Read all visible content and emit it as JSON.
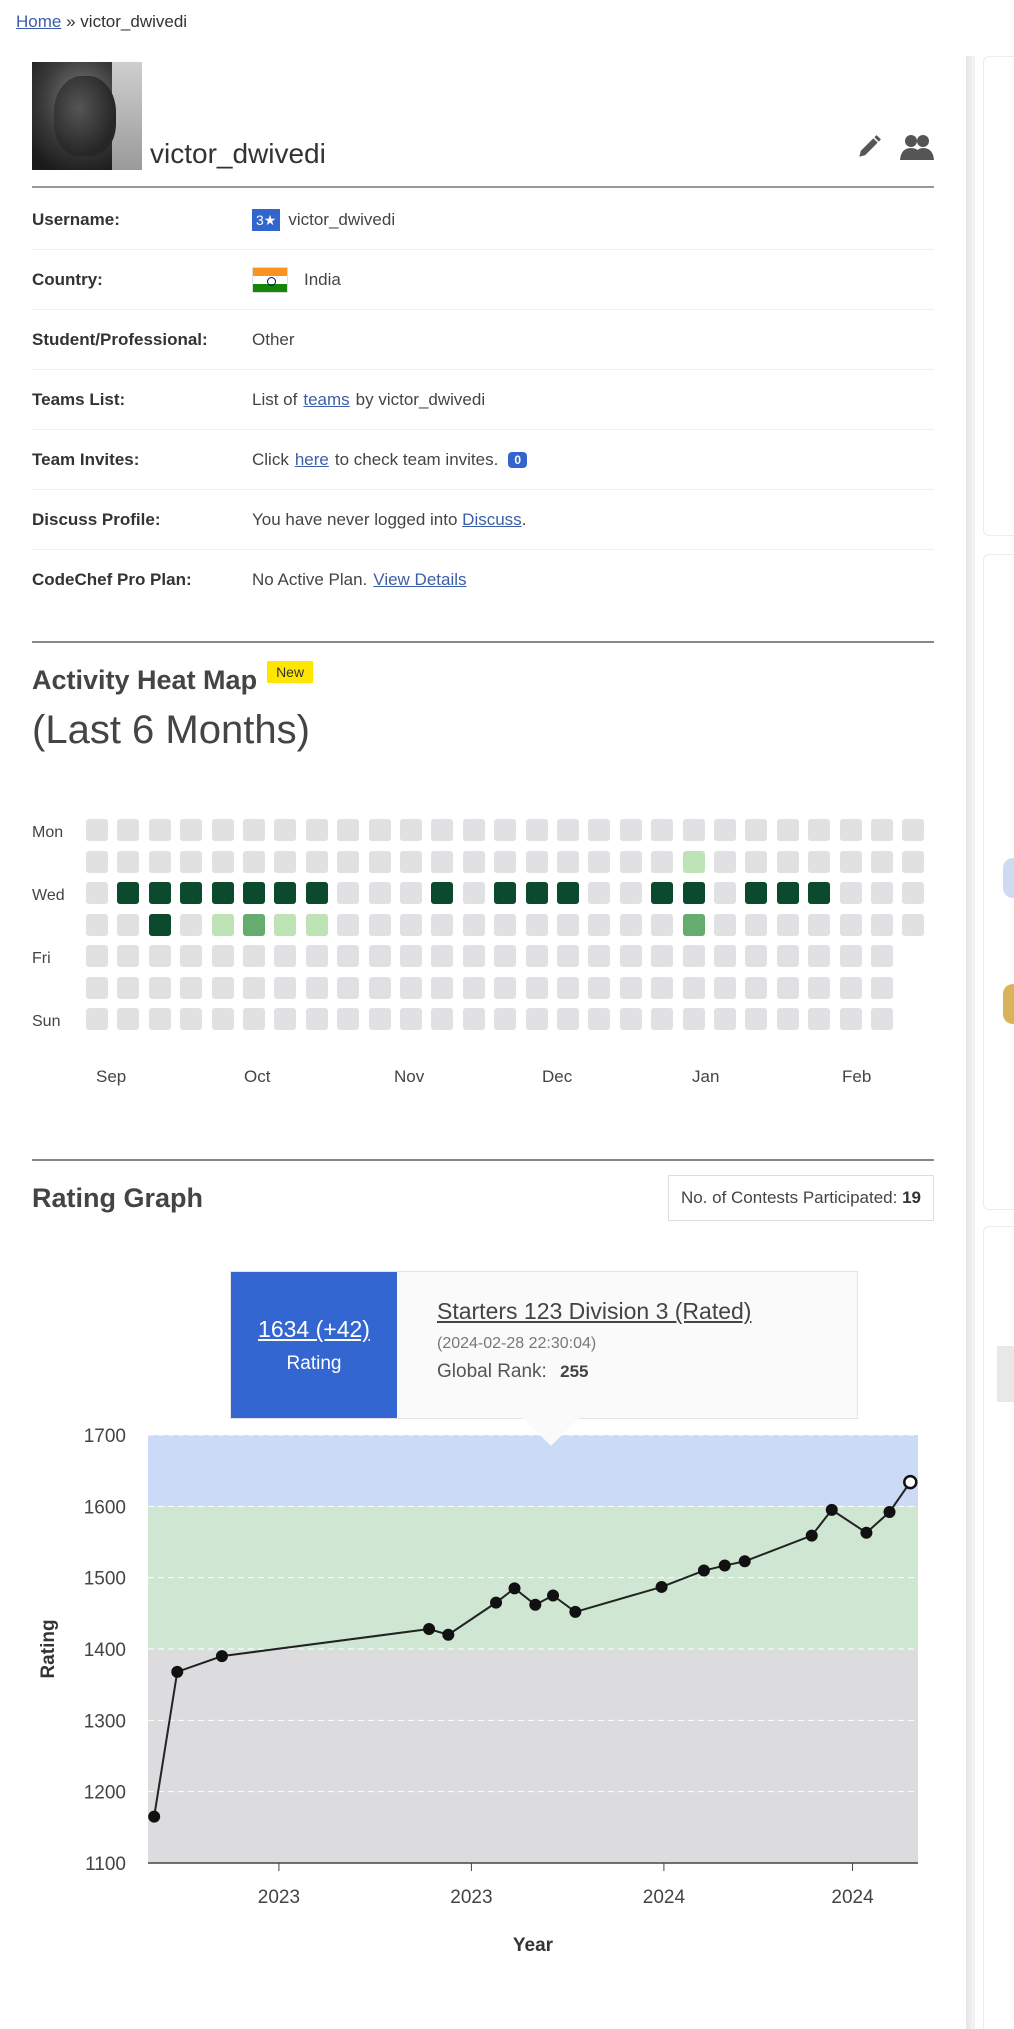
{
  "breadcrumb": {
    "home": "Home",
    "separator": "»",
    "current": "victor_dwivedi"
  },
  "profile": {
    "display_name": "victor_dwivedi",
    "edit_icon": "pencil-icon",
    "users_icon": "users-icon",
    "rows": {
      "username": {
        "label": "Username:",
        "stars": "3★",
        "value": "victor_dwivedi"
      },
      "country": {
        "label": "Country:",
        "value": "India"
      },
      "student": {
        "label": "Student/Professional:",
        "value": "Other"
      },
      "teams": {
        "label": "Teams List:",
        "prefix": "List of",
        "link": "teams",
        "suffix": "by victor_dwivedi"
      },
      "invites": {
        "label": "Team Invites:",
        "prefix": "Click",
        "link": "here",
        "suffix": "to check team invites.",
        "count": "0"
      },
      "discuss": {
        "label": "Discuss Profile:",
        "prefix": "You have never logged into",
        "link": "Discuss",
        "suffix": "."
      },
      "pro": {
        "label": "CodeChef Pro Plan:",
        "prefix": "No Active Plan.",
        "link": "View Details"
      }
    }
  },
  "heatmap": {
    "title": "Activity Heat Map",
    "badge": "New",
    "subtitle": "(Last 6 Months)",
    "day_labels": [
      "Mon",
      "Wed",
      "Fri",
      "Sun"
    ],
    "months": [
      "Sep",
      "Oct",
      "Nov",
      "Dec",
      "Jan",
      "Feb"
    ],
    "weeks": 27,
    "active": [
      {
        "w": 1,
        "d": 2,
        "l": 3
      },
      {
        "w": 2,
        "d": 2,
        "l": 3
      },
      {
        "w": 2,
        "d": 3,
        "l": 3
      },
      {
        "w": 3,
        "d": 2,
        "l": 3
      },
      {
        "w": 4,
        "d": 2,
        "l": 3
      },
      {
        "w": 4,
        "d": 3,
        "l": 1
      },
      {
        "w": 5,
        "d": 2,
        "l": 3
      },
      {
        "w": 5,
        "d": 3,
        "l": 2
      },
      {
        "w": 6,
        "d": 2,
        "l": 3
      },
      {
        "w": 6,
        "d": 3,
        "l": 1
      },
      {
        "w": 7,
        "d": 2,
        "l": 3
      },
      {
        "w": 7,
        "d": 3,
        "l": 1
      },
      {
        "w": 11,
        "d": 2,
        "l": 3
      },
      {
        "w": 13,
        "d": 2,
        "l": 3
      },
      {
        "w": 14,
        "d": 2,
        "l": 3
      },
      {
        "w": 15,
        "d": 2,
        "l": 3
      },
      {
        "w": 18,
        "d": 2,
        "l": 3
      },
      {
        "w": 19,
        "d": 1,
        "l": 1
      },
      {
        "w": 19,
        "d": 2,
        "l": 3
      },
      {
        "w": 19,
        "d": 3,
        "l": 2
      },
      {
        "w": 21,
        "d": 2,
        "l": 3
      },
      {
        "w": 22,
        "d": 2,
        "l": 3
      },
      {
        "w": 23,
        "d": 2,
        "l": 3
      }
    ]
  },
  "rating": {
    "title": "Rating Graph",
    "contests_label": "No. of Contests Participated:",
    "contests_count": "19",
    "tooltip": {
      "rating_value": "1634 (+42)",
      "rating_label": "Rating",
      "contest_name": "Starters 123 Division 3 (Rated)",
      "date": "(2024-02-28 22:30:04)",
      "rank_label": "Global Rank:",
      "rank_value": "255"
    }
  },
  "chart_data": {
    "type": "line",
    "xlabel": "Year",
    "ylabel": "Rating",
    "ylim": [
      1100,
      1700
    ],
    "yticks": [
      1100,
      1200,
      1300,
      1400,
      1500,
      1600,
      1700
    ],
    "xtick_labels": [
      "2023",
      "2023",
      "2024",
      "2024"
    ],
    "bands": [
      {
        "from": 1100,
        "to": 1400,
        "color": "#dcdcdf"
      },
      {
        "from": 1400,
        "to": 1600,
        "color": "#cfe7d2"
      },
      {
        "from": 1600,
        "to": 1700,
        "color": "#cbdaf7"
      }
    ],
    "series": [
      {
        "values": [
          1165,
          1368,
          1390,
          1428,
          1420,
          1465,
          1485,
          1462,
          1475,
          1452,
          1487,
          1510,
          1517,
          1523,
          1559,
          1595,
          1563,
          1592,
          1634
        ],
        "x_frac": [
          0.008,
          0.038,
          0.096,
          0.365,
          0.39,
          0.452,
          0.476,
          0.503,
          0.526,
          0.555,
          0.667,
          0.722,
          0.749,
          0.775,
          0.862,
          0.888,
          0.933,
          0.963,
          0.99
        ]
      }
    ],
    "selected_index": 18
  }
}
